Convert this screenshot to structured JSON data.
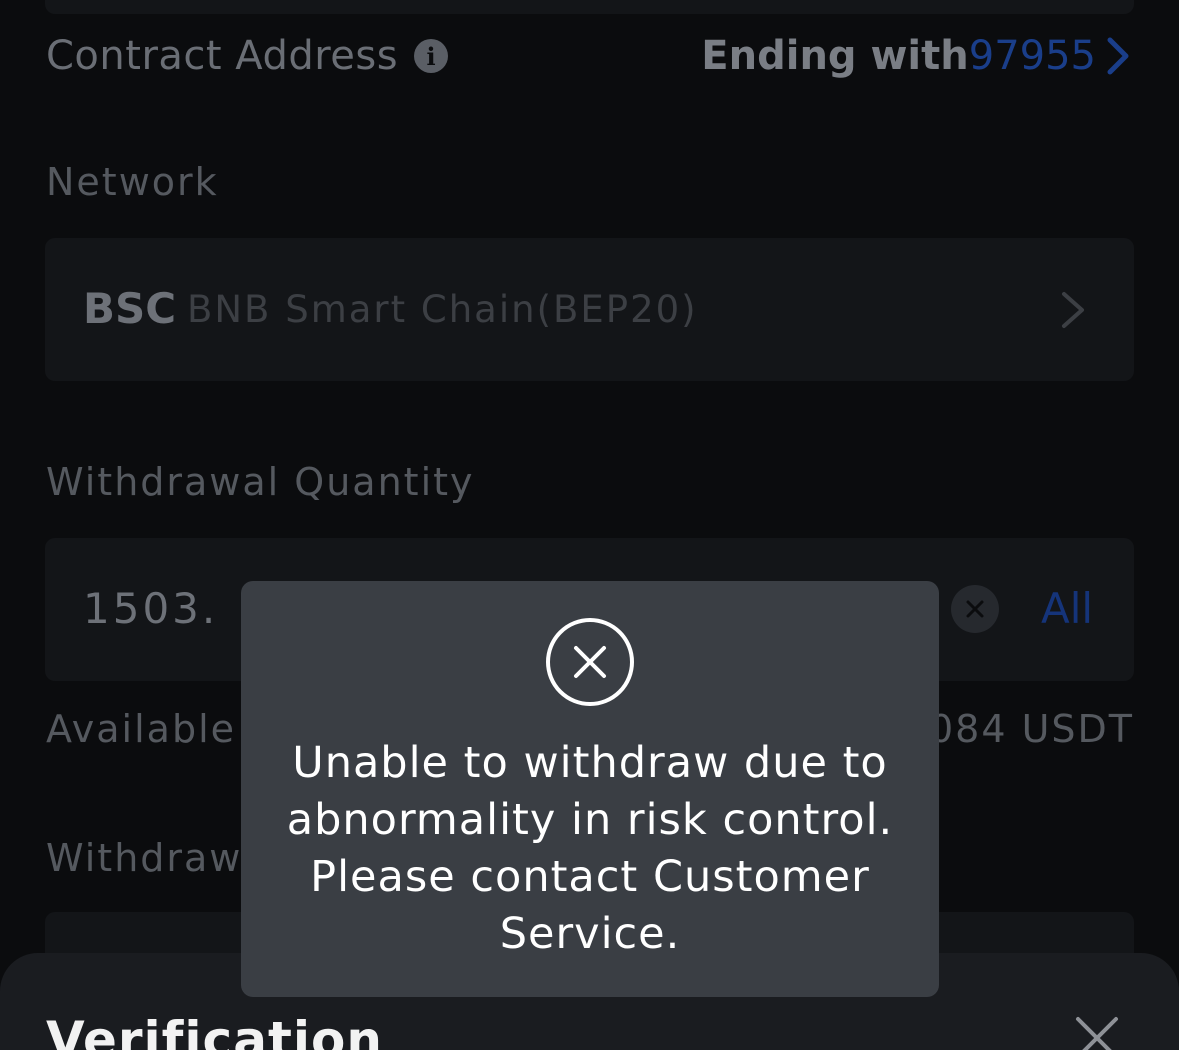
{
  "form": {
    "contract_label": "Contract Address",
    "contract_ending_label": "Ending with",
    "contract_ending_value": "97955",
    "network_label": "Network",
    "network_code": "BSC",
    "network_name": "BNB Smart Chain(BEP20)",
    "quantity_label": "Withdrawal Quantity",
    "quantity_value": "1503.",
    "all_label": "All",
    "available_label": "Available",
    "available_value": "084 USDT",
    "withdrawal_label_partial": "Withdraw"
  },
  "toast": {
    "message": "Unable to withdraw due to abnormality in risk control. Please contact Customer Service."
  },
  "sheet": {
    "title": "Verification"
  },
  "colors": {
    "accent_blue": "#1a3e8a",
    "toast_bg": "#3a3e44"
  }
}
